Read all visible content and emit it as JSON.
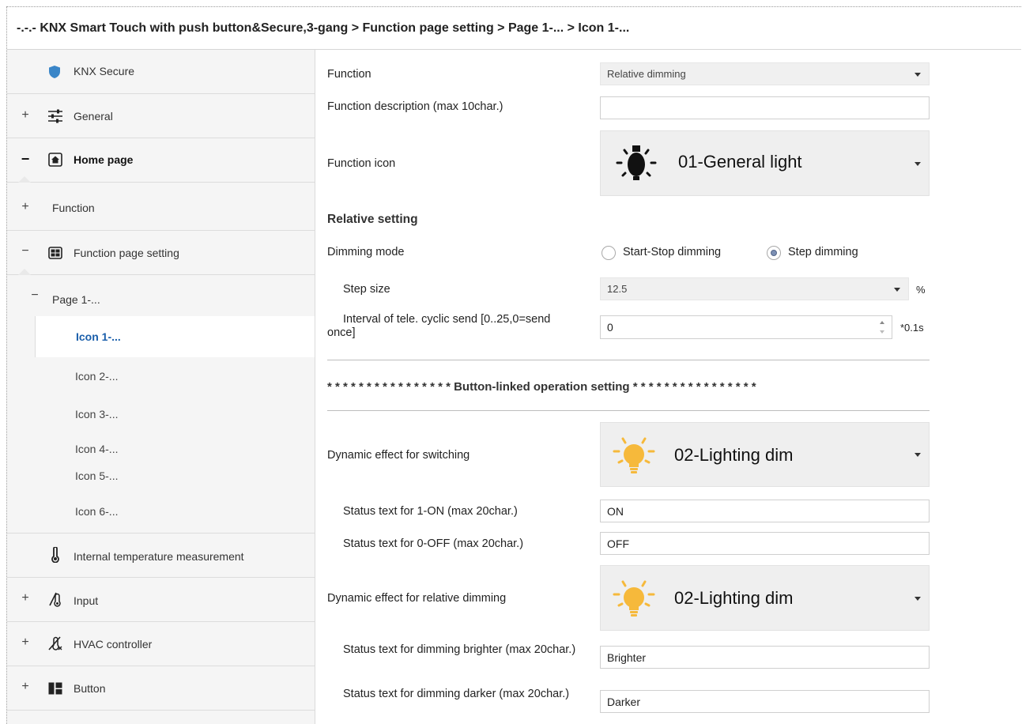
{
  "breadcrumb": "-.-.- KNX Smart Touch with push button&Secure,3-gang > Function page setting > Page 1-... > Icon 1-...",
  "sidebar": {
    "items": [
      {
        "label": "KNX Secure",
        "toggle": "",
        "icon": "shield-icon"
      },
      {
        "label": "General",
        "toggle": "+",
        "icon": "sliders-icon"
      },
      {
        "label": "Home page",
        "toggle": "−",
        "icon": "home-icon"
      },
      {
        "label": "Function",
        "toggle": "+",
        "icon": ""
      },
      {
        "label": "Function page setting",
        "toggle": "−",
        "icon": "grid-icon"
      },
      {
        "label": "Page 1-...",
        "toggle": "−",
        "icon": ""
      },
      {
        "label": "Icon 1-...",
        "toggle": "",
        "icon": ""
      },
      {
        "label": "Icon 2-...",
        "toggle": "",
        "icon": ""
      },
      {
        "label": "Icon 3-...",
        "toggle": "",
        "icon": ""
      },
      {
        "label": "Icon 4-...",
        "toggle": "",
        "icon": ""
      },
      {
        "label": "Icon 5-...",
        "toggle": "",
        "icon": ""
      },
      {
        "label": "Icon 6-...",
        "toggle": "",
        "icon": ""
      },
      {
        "label": "Internal temperature measurement",
        "toggle": "",
        "icon": "thermometer-icon"
      },
      {
        "label": "Input",
        "toggle": "+",
        "icon": "input-icon"
      },
      {
        "label": "HVAC controller",
        "toggle": "+",
        "icon": "hvac-icon"
      },
      {
        "label": "Button",
        "toggle": "+",
        "icon": "button-icon"
      }
    ]
  },
  "main": {
    "function": {
      "label": "Function",
      "value": "Relative dimming"
    },
    "function_description": {
      "label": "Function description (max 10char.)",
      "value": ""
    },
    "function_icon": {
      "label": "Function icon",
      "value": "01-General light",
      "icon": "bulb-black-icon"
    },
    "relative_setting": "Relative setting",
    "dimming_mode": {
      "label": "Dimming mode",
      "options": [
        "Start-Stop dimming",
        "Step dimming"
      ],
      "selected": "Step dimming"
    },
    "step_size": {
      "label": "Step size",
      "value": "12.5",
      "unit": "%"
    },
    "interval": {
      "label": "Interval of tele. cyclic send [0..25,0=send once]",
      "value": "0",
      "unit": "*0.1s"
    },
    "section_title": "* * * * * * * * * * * * * * * * Button-linked operation setting * * * * * * * * * * * * * * * *",
    "dynamic_switching": {
      "label": "Dynamic effect for switching",
      "value": "02-Lighting dim",
      "icon": "bulb-yellow-icon"
    },
    "status_on": {
      "label": "Status text for 1-ON (max 20char.)",
      "value": "ON"
    },
    "status_off": {
      "label": "Status text for 0-OFF (max 20char.)",
      "value": "OFF"
    },
    "dynamic_dimming": {
      "label": "Dynamic effect  for relative dimming",
      "value": "02-Lighting dim",
      "icon": "bulb-yellow-icon"
    },
    "status_brighter": {
      "label": "Status text for dimming brighter (max 20char.)",
      "value": "Brighter"
    },
    "status_darker": {
      "label": "Status text for dimming darker (max 20char.)",
      "value": "Darker"
    }
  },
  "colors": {
    "selected_link": "#1b5fab",
    "sidebar_bg": "#f5f5f5",
    "dropdown_bg": "#f0f0f0",
    "shield": "#3a86c8",
    "bulb_yellow": "#f6b93b"
  }
}
